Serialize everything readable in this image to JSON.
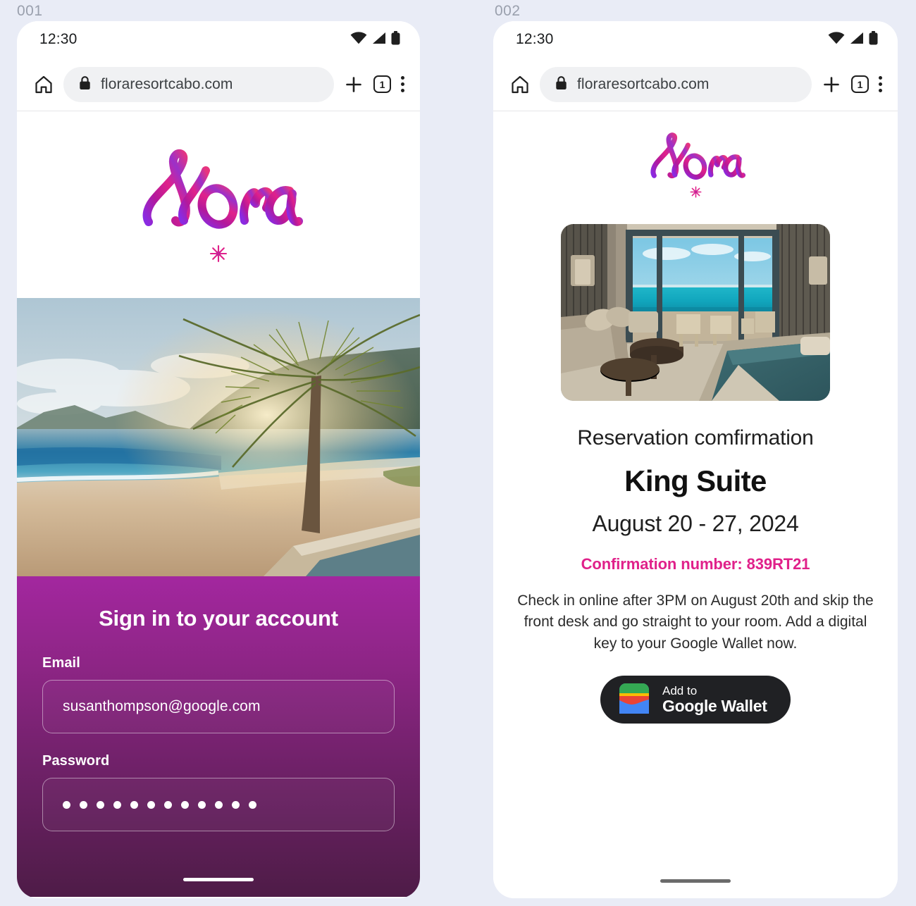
{
  "page": {
    "background_color": "#e9ecf6",
    "frames": [
      {
        "label": "001"
      },
      {
        "label": "002"
      }
    ]
  },
  "phone1": {
    "status": {
      "time": "12:30",
      "wifi_icon": "wifi-icon",
      "signal_icon": "signal-icon",
      "battery_icon": "battery-icon"
    },
    "browser": {
      "home_icon": "home-icon",
      "lock_icon": "lock-icon",
      "url": "floraresortcabo.com",
      "new_tab_icon": "plus-icon",
      "tab_count": "1",
      "menu_icon": "kebab-menu-icon"
    },
    "brand": {
      "wordmark": "Flora",
      "flower_icon": "flower-asterisk-icon"
    },
    "hero": {
      "image_alt": "tropical-beach-sunset-palm"
    },
    "signin": {
      "heading": "Sign in to your account",
      "email_label": "Email",
      "email_value": "susanthompson@google.com",
      "email_placeholder": "Email",
      "password_label": "Password",
      "password_masked_length": 12,
      "password_placeholder": "Password"
    },
    "home_indicator": "home-indicator"
  },
  "phone2": {
    "status": {
      "time": "12:30",
      "wifi_icon": "wifi-icon",
      "signal_icon": "signal-icon",
      "battery_icon": "battery-icon"
    },
    "browser": {
      "home_icon": "home-icon",
      "lock_icon": "lock-icon",
      "url": "floraresortcabo.com",
      "new_tab_icon": "plus-icon",
      "tab_count": "1",
      "menu_icon": "kebab-menu-icon"
    },
    "brand": {
      "wordmark": "Flora",
      "flower_icon": "flower-asterisk-icon"
    },
    "room_image_alt": "hotel-suite-ocean-view",
    "confirmation": {
      "subtitle": "Reservation comfirmation",
      "room": "King Suite",
      "dates": "August 20 - 27, 2024",
      "number_line": "Confirmation number: 839RT21",
      "body": "Check in online after 3PM on August 20th and skip the front desk and go straight to your room. Add a digital key to your Google Wallet now."
    },
    "wallet_button": {
      "line1": "Add to",
      "line2": "Google Wallet",
      "icon": "google-wallet-icon"
    },
    "home_indicator": "home-indicator"
  },
  "colors": {
    "brand_pink": "#e0218a",
    "brand_purple": "#a3279f",
    "panel_gradient_start": "#a3279f",
    "panel_gradient_end": "#4e1c47",
    "wallet_button_bg": "#202124"
  }
}
